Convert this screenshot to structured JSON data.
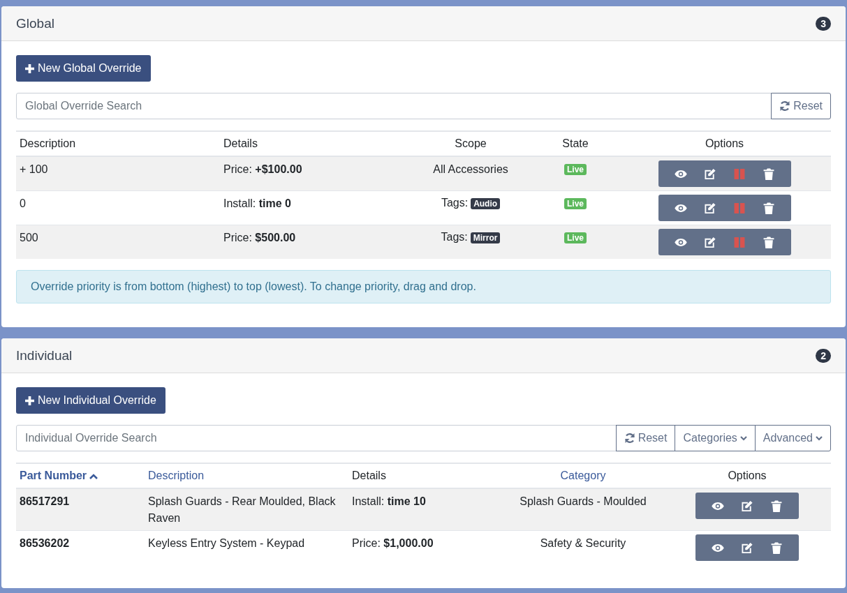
{
  "panels": [
    {
      "title": "Global",
      "count": "3",
      "new_button": "New Global Override",
      "search": {
        "placeholder": "Global Override Search"
      },
      "search_buttons": [
        {
          "kind": "reset",
          "label": "Reset"
        }
      ],
      "table": {
        "columns": [
          {
            "label": "Description",
            "sortable": false,
            "sorted": false
          },
          {
            "label": "Details",
            "sortable": false,
            "sorted": false
          },
          {
            "label": "Scope",
            "sortable": false,
            "sorted": false
          },
          {
            "label": "State",
            "sortable": false,
            "sorted": false
          },
          {
            "label": "Options",
            "sortable": false,
            "sorted": false
          }
        ],
        "rows": [
          {
            "cells": [
              {
                "kind": "text",
                "text": "+ 100"
              },
              {
                "kind": "rich",
                "text": "Price: **+$100.00**"
              },
              {
                "kind": "text",
                "text": "All Accessories"
              },
              {
                "kind": "status",
                "text": "Live"
              },
              {
                "kind": "actions",
                "actions": [
                  {
                    "kind": "view"
                  },
                  {
                    "kind": "edit"
                  },
                  {
                    "kind": "pause"
                  },
                  {
                    "kind": "delete"
                  }
                ]
              }
            ]
          },
          {
            "cells": [
              {
                "kind": "text",
                "text": "0"
              },
              {
                "kind": "rich",
                "text": "Install: **time 0**"
              },
              {
                "kind": "tags",
                "text": "Tags:",
                "tags": [
                  "Audio"
                ]
              },
              {
                "kind": "status",
                "text": "Live"
              },
              {
                "kind": "actions",
                "actions": [
                  {
                    "kind": "view"
                  },
                  {
                    "kind": "edit"
                  },
                  {
                    "kind": "pause"
                  },
                  {
                    "kind": "delete"
                  }
                ]
              }
            ]
          },
          {
            "cells": [
              {
                "kind": "text",
                "text": "500"
              },
              {
                "kind": "rich",
                "text": "Price: **$500.00**"
              },
              {
                "kind": "tags",
                "text": "Tags:",
                "tags": [
                  "Mirror"
                ]
              },
              {
                "kind": "status",
                "text": "Live"
              },
              {
                "kind": "actions",
                "actions": [
                  {
                    "kind": "view"
                  },
                  {
                    "kind": "edit"
                  },
                  {
                    "kind": "pause"
                  },
                  {
                    "kind": "delete"
                  }
                ]
              }
            ]
          }
        ]
      },
      "alert": "Override priority is from bottom (highest) to top (lowest). To change priority, drag and drop."
    },
    {
      "title": "Individual",
      "count": "2",
      "new_button": "New Individual Override",
      "search": {
        "placeholder": "Individual Override Search"
      },
      "search_buttons": [
        {
          "kind": "reset",
          "label": "Reset"
        },
        {
          "kind": "dropdown",
          "label": "Categories"
        },
        {
          "kind": "dropdown",
          "label": "Advanced"
        }
      ],
      "table": {
        "columns": [
          {
            "label": "Part Number",
            "sortable": true,
            "sorted": true
          },
          {
            "label": "Description",
            "sortable": true,
            "sorted": false
          },
          {
            "label": "Details",
            "sortable": false,
            "sorted": false
          },
          {
            "label": "Category",
            "sortable": true,
            "sorted": false
          },
          {
            "label": "Options",
            "sortable": false,
            "sorted": false
          }
        ],
        "rows": [
          {
            "cells": [
              {
                "kind": "bold",
                "text": "86517291"
              },
              {
                "kind": "text",
                "text": "Splash Guards - Rear Moulded, Black Raven"
              },
              {
                "kind": "rich",
                "text": "Install: **time 10**"
              },
              {
                "kind": "text",
                "text": "Splash Guards - Moulded"
              },
              {
                "kind": "actions",
                "actions": [
                  {
                    "kind": "view"
                  },
                  {
                    "kind": "edit"
                  },
                  {
                    "kind": "delete"
                  }
                ]
              }
            ]
          },
          {
            "cells": [
              {
                "kind": "bold",
                "text": "86536202"
              },
              {
                "kind": "text",
                "text": "Keyless Entry System - Keypad"
              },
              {
                "kind": "rich",
                "text": "Price: **$1,000.00**"
              },
              {
                "kind": "text",
                "text": "Safety & Security"
              },
              {
                "kind": "actions",
                "actions": [
                  {
                    "kind": "view"
                  },
                  {
                    "kind": "edit"
                  },
                  {
                    "kind": "delete"
                  }
                ]
              }
            ]
          }
        ]
      }
    }
  ]
}
